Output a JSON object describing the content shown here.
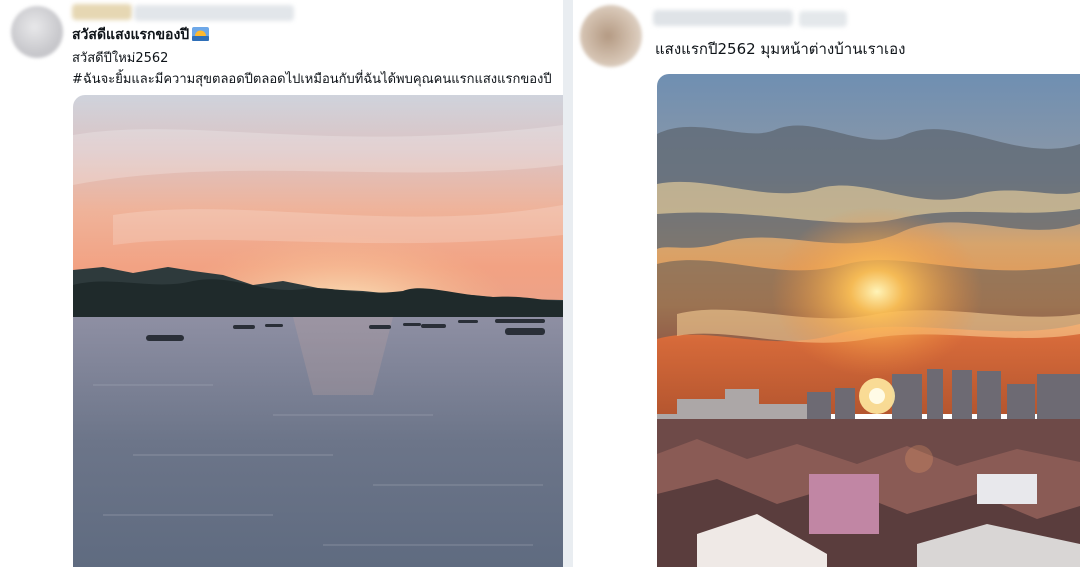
{
  "post_left": {
    "author_name": "",
    "timestamp": "",
    "title": "สวัสดีแสงแรกของปี",
    "title_emoji_icon": "sunrise-emoji-icon",
    "line2": "สวัสดีปีใหม่2562",
    "hashtag_line": "#ฉันจะยิ้มและมีความสุขตลอดปีตลอดไปเหมือนกับที่ฉันได้พบคุณคนแรกแสงแรกของปี",
    "image_alt": "sunset over bay with fishing boats"
  },
  "post_right": {
    "author_name": "",
    "timestamp": "",
    "text": "แสงแรกปี2562 มุมหน้าต่างบ้านเราเอง",
    "image_alt": "sunrise over city rooftops"
  },
  "colors": {
    "text": "#0f1419",
    "gutter": "#e9edf1"
  }
}
